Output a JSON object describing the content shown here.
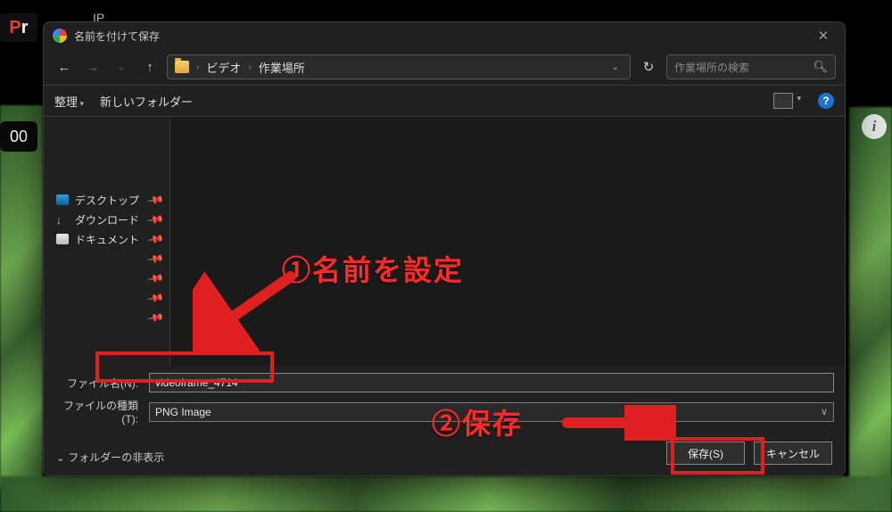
{
  "background": {
    "pr_badge_left": "P",
    "pr_badge_right": "r",
    "ip_label": "IP",
    "yt_time": "00",
    "info_icon": "i"
  },
  "dialog": {
    "title": "名前を付けて保存",
    "close_glyph": "✕",
    "nav": {
      "back": "←",
      "forward": "→",
      "up": "↑"
    },
    "breadcrumb": {
      "segments": [
        "ビデオ",
        "作業場所"
      ],
      "sep": "›"
    },
    "refresh_glyph": "↻",
    "search_placeholder": "作業場所の検索",
    "toolbar": {
      "organize": "整理",
      "new_folder": "新しいフォルダー",
      "help_glyph": "?"
    },
    "sidebar": {
      "items": [
        {
          "icon": "desktop",
          "label": "デスクトップ"
        },
        {
          "icon": "download",
          "label": "ダウンロード"
        },
        {
          "icon": "doc",
          "label": "ドキュメント"
        }
      ]
    },
    "fields": {
      "filename_label": "ファイル名(N):",
      "filename_value": "videoframe_4714",
      "filetype_label": "ファイルの種類(T):",
      "filetype_value": "PNG Image"
    },
    "footer": {
      "hide_folders": "フォルダーの非表示",
      "save": "保存(S)",
      "cancel": "キャンセル"
    }
  },
  "annotations": {
    "step1": "名前を設定",
    "step1_num": "①",
    "step2": "保存",
    "step2_num": "②"
  }
}
